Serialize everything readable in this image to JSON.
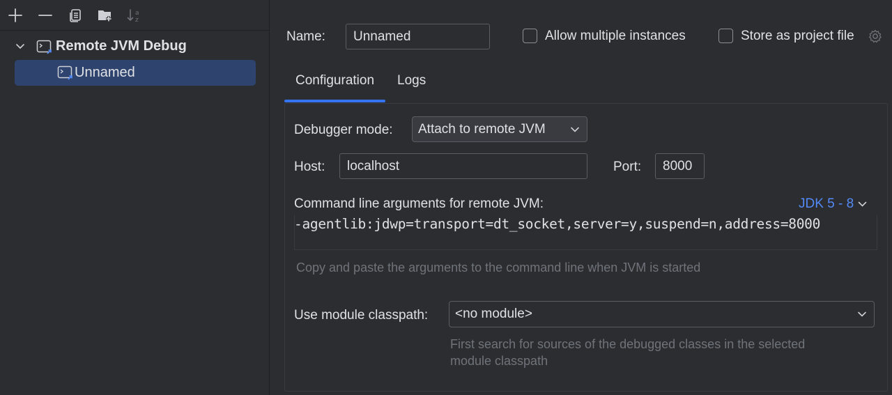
{
  "toolbar": {
    "add_icon": "plus-icon",
    "remove_icon": "minus-icon",
    "copy_icon": "copy-icon",
    "folder_icon": "new-folder-icon",
    "sort_icon": "sort-alpha-icon"
  },
  "tree": {
    "group_label": "Remote JVM Debug",
    "item_label": "Unnamed"
  },
  "header": {
    "name_label": "Name:",
    "name_value": "Unnamed",
    "allow_multiple_label": "Allow multiple instances",
    "store_project_label": "Store as project file"
  },
  "tabs": [
    {
      "label": "Configuration",
      "active": true
    },
    {
      "label": "Logs",
      "active": false
    }
  ],
  "config": {
    "debugger_mode_label": "Debugger mode:",
    "debugger_mode_value": "Attach to remote JVM",
    "host_label": "Host:",
    "host_value": "localhost",
    "port_label": "Port:",
    "port_value": "8000",
    "cmdline_label": "Command line arguments for remote JVM:",
    "jdk_link": "JDK 5 - 8",
    "cmdline_value": "-agentlib:jdwp=transport=dt_socket,server=y,suspend=n,address=8000",
    "cmdline_hint": "Copy and paste the arguments to the command line when JVM is started",
    "module_label": "Use module classpath:",
    "module_value": "<no module>",
    "module_hint_line1": "First search for sources of the debugged classes in the selected",
    "module_hint_line2": "module classpath"
  },
  "colors": {
    "background": "#2b2d30",
    "selection": "#2e436e",
    "accent": "#3574f0",
    "link": "#548af7",
    "hint": "#6f737a"
  }
}
